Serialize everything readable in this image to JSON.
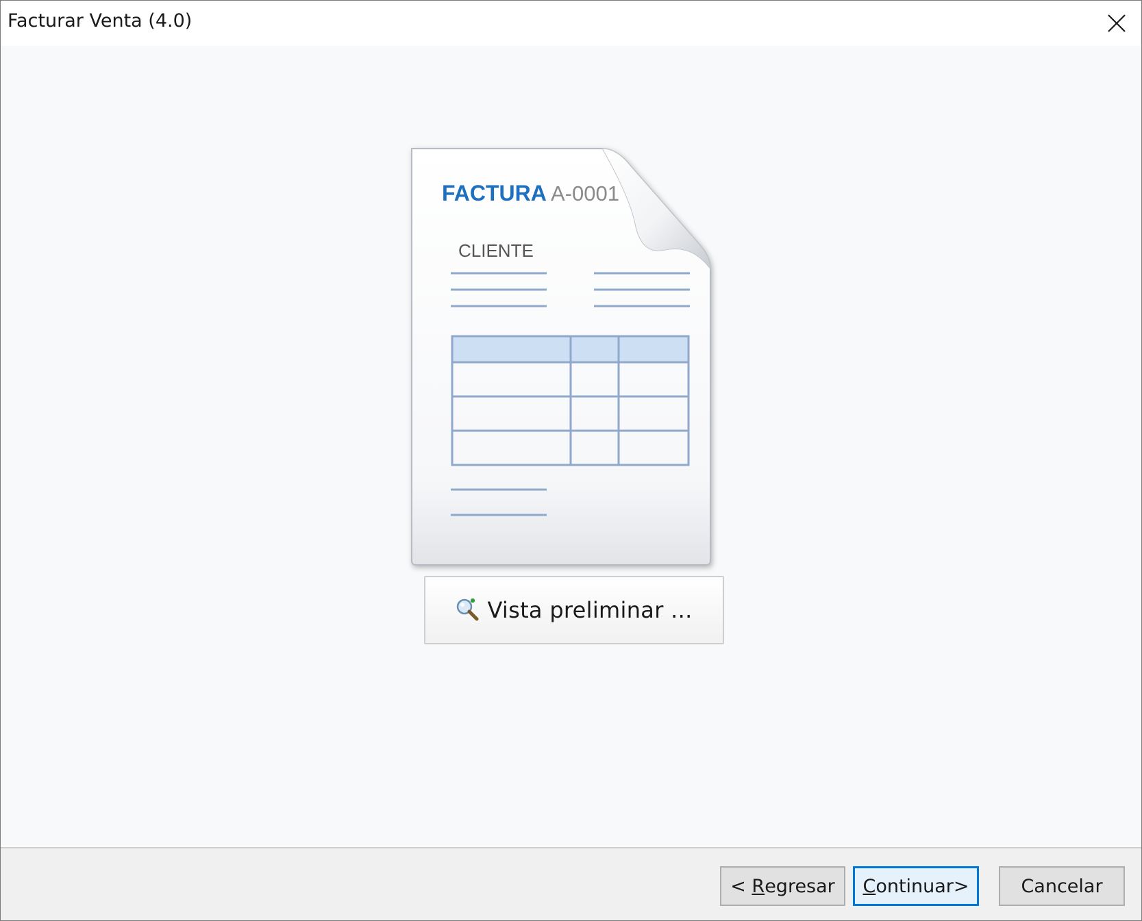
{
  "window": {
    "title": "Facturar Venta (4.0)"
  },
  "illustration": {
    "heading": "FACTURA",
    "number": "A-0001",
    "client_label": "CLIENTE",
    "colors": {
      "heading": "#1e6fbf",
      "number": "#8a8a8a",
      "lines": "#8fa8cc",
      "table_header": "#cddff3"
    }
  },
  "preview_button": {
    "label": "Vista preliminar ...",
    "icon": "magnifier-plus-icon"
  },
  "footer": {
    "back": {
      "prefix": "< ",
      "mnemonic": "R",
      "rest": "egresar"
    },
    "continue": {
      "mnemonic": "C",
      "rest": "ontinuar>"
    },
    "cancel": {
      "label": "Cancelar"
    }
  },
  "close_icon": "close-icon"
}
